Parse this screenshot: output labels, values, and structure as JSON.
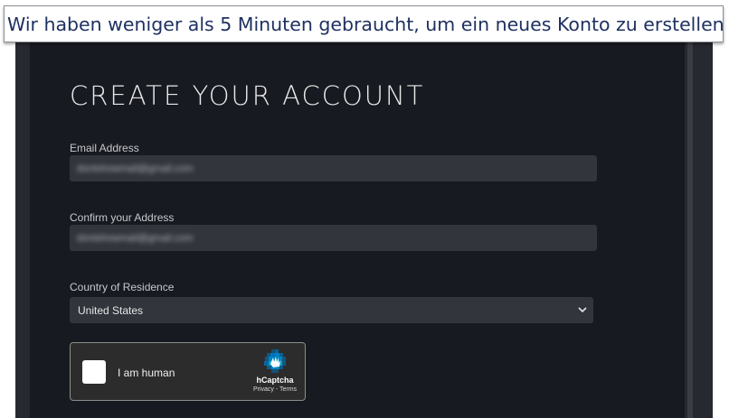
{
  "caption": {
    "text": "Wir haben weniger als 5 Minuten gebraucht, um ein neues Konto zu erstellen"
  },
  "form": {
    "title": "CREATE YOUR ACCOUNT",
    "email": {
      "label": "Email Address",
      "value": "dontshowmail@gmail.com"
    },
    "confirm_email": {
      "label": "Confirm your Address",
      "value": "dontshowmail@gmail.com"
    },
    "country": {
      "label": "Country of Residence",
      "selected": "United States",
      "chevron_icon": "chevron-down-icon"
    },
    "captcha": {
      "label": "I am human",
      "brand": "hCaptcha",
      "links": "Privacy - Terms",
      "logo_icon": "hcaptcha-hand-icon"
    }
  },
  "colors": {
    "caption_text": "#1f3161",
    "frame": "#26292f",
    "panel": "#181a21",
    "input": "#32353c",
    "captcha_accent": "#0074bf"
  }
}
